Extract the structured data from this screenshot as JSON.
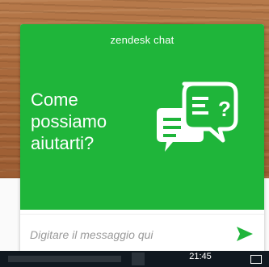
{
  "widget": {
    "brand": "zendesk chat",
    "greeting_lines": [
      "Come",
      "possiamo",
      "aiutarti?"
    ],
    "input_placeholder": "Digitare il messaggio qui",
    "accent_color": "#1fb53a",
    "send_icon": "send-arrow-icon",
    "illustration_icon": "chat-bubbles-icon"
  },
  "taskbar": {
    "time": "21:45"
  }
}
